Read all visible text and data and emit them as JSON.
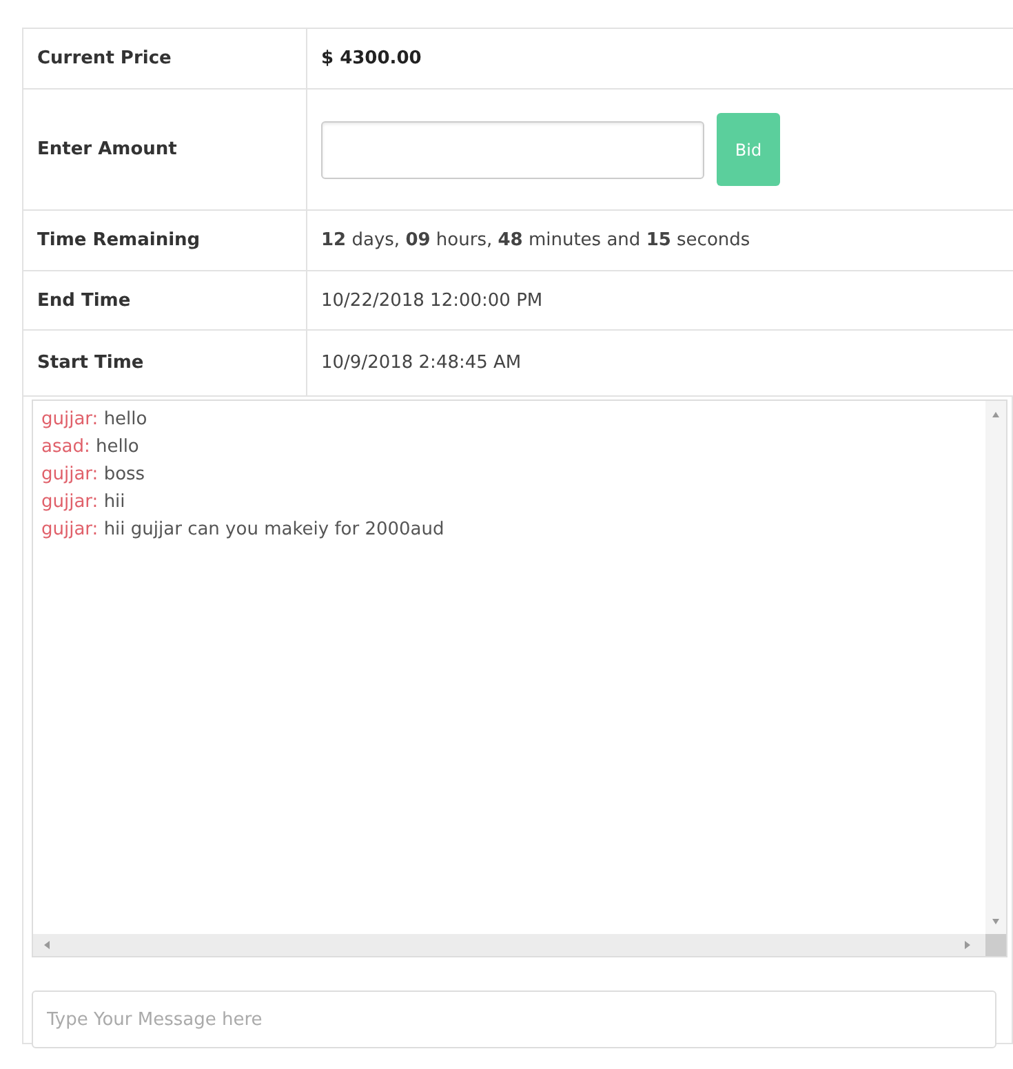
{
  "details": [
    {
      "kind": "text",
      "label": "Current Price",
      "value": "$ 4300.00",
      "bold": true
    },
    {
      "kind": "bid",
      "label": "Enter Amount",
      "button": "Bid"
    },
    {
      "kind": "text",
      "label": "Time Remaining",
      "value": "**12** days, **09** hours, **48** minutes and **15** seconds",
      "bold": false
    },
    {
      "kind": "text",
      "label": "End Time",
      "value": "10/22/2018 12:00:00 PM",
      "bold": false
    },
    {
      "kind": "text",
      "label": "Start Time",
      "value": "10/9/2018 2:48:45 AM",
      "bold": false
    }
  ],
  "chat": {
    "messages": [
      {
        "user": "gujjar:",
        "text": "hello"
      },
      {
        "user": "asad:",
        "text": "hello"
      },
      {
        "user": "gujjar:",
        "text": "boss"
      },
      {
        "user": "gujjar:",
        "text": "hii"
      },
      {
        "user": "gujjar:",
        "text": "hii gujjar can you makeiy for 2000aud"
      }
    ],
    "input": {
      "placeholder": "Type Your Message here"
    }
  }
}
